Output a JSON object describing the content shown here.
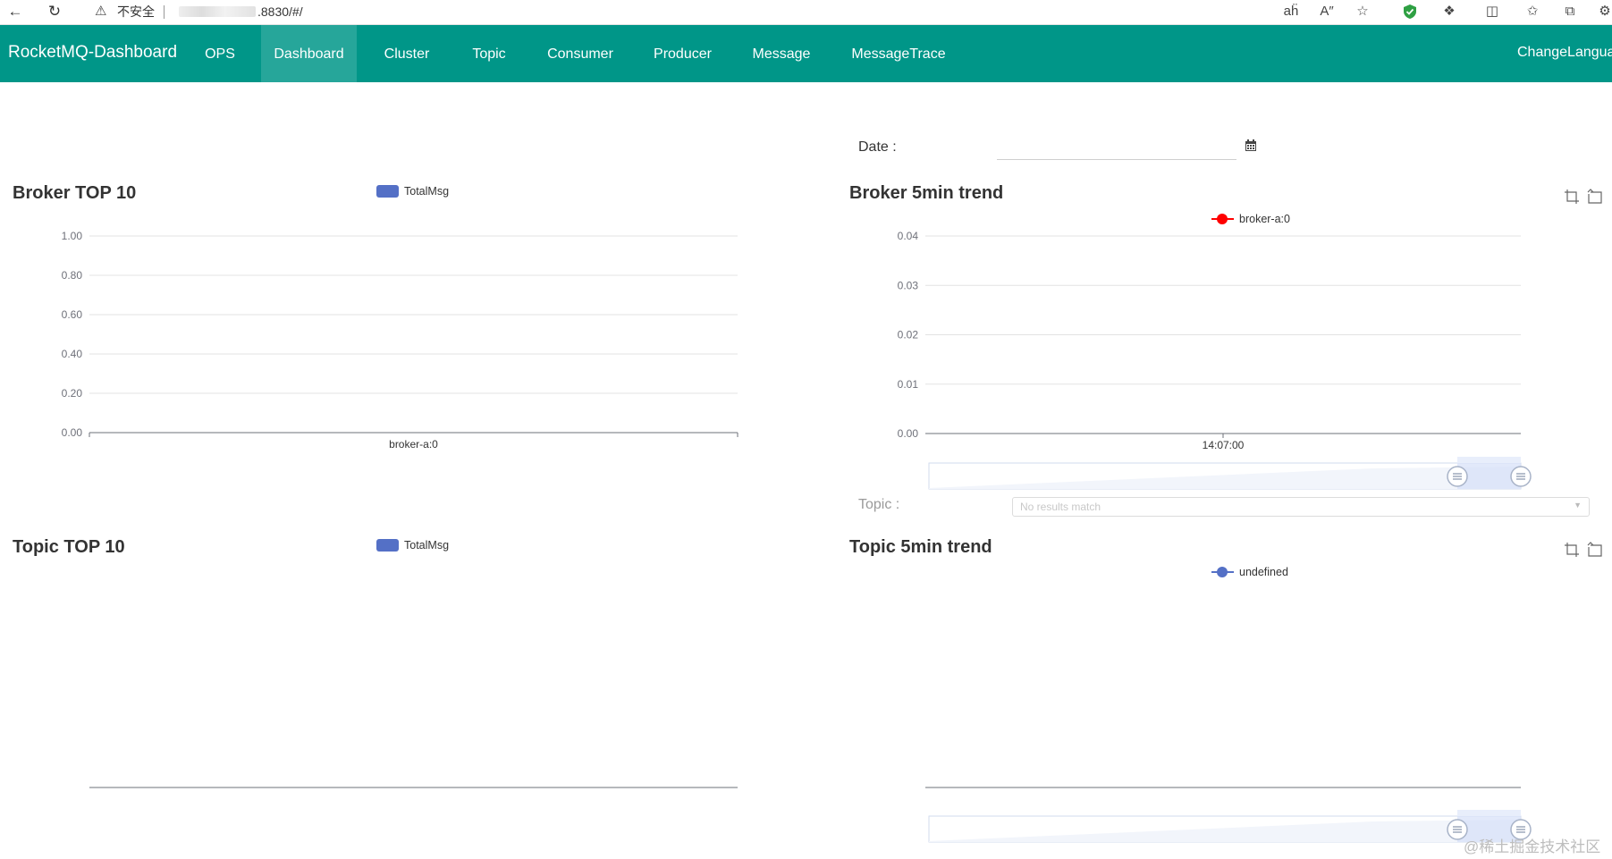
{
  "browser": {
    "security_text": "不安全",
    "url": ".8830/#/",
    "icons": [
      "back-icon",
      "reload-icon",
      "warning-icon",
      "translate-icon",
      "read-aloud-icon",
      "favorite-icon",
      "shield-icon",
      "extensions-icon",
      "split-screen-icon",
      "favorites-icon",
      "collections-icon",
      "profile-icon"
    ]
  },
  "navbar": {
    "brand": "RocketMQ-Dashboard",
    "items": [
      {
        "label": "OPS"
      },
      {
        "label": "Dashboard",
        "active": true
      },
      {
        "label": "Cluster"
      },
      {
        "label": "Topic"
      },
      {
        "label": "Consumer"
      },
      {
        "label": "Producer"
      },
      {
        "label": "Message"
      },
      {
        "label": "MessageTrace"
      }
    ],
    "language": "ChangeLanguage",
    "color": "#009688",
    "active_color": "#26a69a"
  },
  "date_filter": {
    "label": "Date :",
    "value": ""
  },
  "topic_filter": {
    "label": "Topic :",
    "placeholder": "No results match"
  },
  "watermark": "@稀土掘金技术社区",
  "chart_data": [
    {
      "id": "broker-top10",
      "type": "bar",
      "title": "Broker TOP 10",
      "legend": [
        "TotalMsg"
      ],
      "categories": [
        "broker-a:0"
      ],
      "series": [
        {
          "name": "TotalMsg",
          "values": [
            0
          ]
        }
      ],
      "yticks": [
        "1.00",
        "0.80",
        "0.60",
        "0.40",
        "0.20",
        "0.00"
      ],
      "ylim": [
        0,
        1
      ],
      "grid": true,
      "color": "#5470c6"
    },
    {
      "id": "broker-5min",
      "type": "line",
      "title": "Broker 5min trend",
      "legend": [
        "broker-a:0"
      ],
      "x": [
        "14:07:00"
      ],
      "series": [
        {
          "name": "broker-a:0",
          "values": []
        }
      ],
      "yticks": [
        "0.04",
        "0.03",
        "0.02",
        "0.01",
        "0.00"
      ],
      "ylim": [
        0,
        0.04
      ],
      "grid": true,
      "color": "#ff0000"
    },
    {
      "id": "topic-top10",
      "type": "bar",
      "title": "Topic TOP 10",
      "legend": [
        "TotalMsg"
      ],
      "categories": [],
      "series": [
        {
          "name": "TotalMsg",
          "values": []
        }
      ],
      "color": "#5470c6"
    },
    {
      "id": "topic-5min",
      "type": "line",
      "title": "Topic 5min trend",
      "legend": [
        "undefined"
      ],
      "x": [],
      "series": [
        {
          "name": "undefined",
          "values": []
        }
      ],
      "color": "#5470c6"
    }
  ]
}
